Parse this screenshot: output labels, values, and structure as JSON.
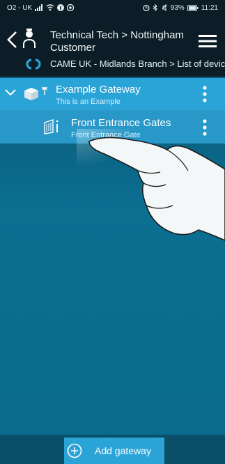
{
  "statusbar": {
    "carrier": "O2 - UK",
    "battery": "93%",
    "time": "11:21"
  },
  "header": {
    "title": "Technical Tech > Nottingham Customer",
    "breadcrumb": "CAME UK - Midlands Branch > List of devices"
  },
  "gateway": {
    "name": "Example Gateway",
    "description": "This is an Example"
  },
  "device": {
    "name": "Front Entrance Gates",
    "type": "Front Entrance Gate"
  },
  "footer": {
    "add_label": "Add gateway"
  },
  "icons": [
    "back-icon",
    "user-icon",
    "menu-icon",
    "came-logo-icon",
    "chevron-down-icon",
    "gateway-icon",
    "gate-icon",
    "more-vert-icon",
    "add-circle-icon"
  ],
  "colors": {
    "header_bg": "#0c1d27",
    "accent": "#2aa3d6",
    "content_bg": "#0b6f92"
  }
}
